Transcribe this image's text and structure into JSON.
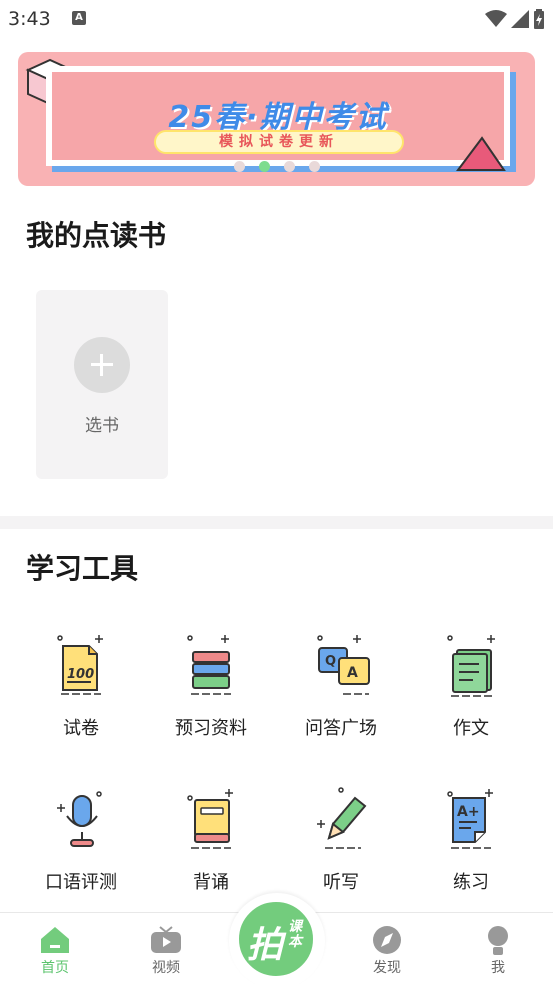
{
  "status_bar": {
    "time": "3:43",
    "notification_letter": "A"
  },
  "banner": {
    "title": "25春·期中考试",
    "subtitle": "模拟试卷更新",
    "dots": 4,
    "active_dot": 1
  },
  "my_books": {
    "title": "我的点读书",
    "add_label": "选书"
  },
  "tools": {
    "title": "学习工具",
    "items": [
      {
        "label": "试卷",
        "icon": "exam-paper-icon"
      },
      {
        "label": "预习资料",
        "icon": "book-stack-icon"
      },
      {
        "label": "问答广场",
        "icon": "qa-bubbles-icon"
      },
      {
        "label": "作文",
        "icon": "notebook-icon"
      },
      {
        "label": "口语评测",
        "icon": "microphone-icon"
      },
      {
        "label": "背诵",
        "icon": "yellow-book-icon"
      },
      {
        "label": "听写",
        "icon": "pencil-icon"
      },
      {
        "label": "练习",
        "icon": "a-plus-sheet-icon"
      }
    ]
  },
  "bottom_nav": {
    "items": [
      {
        "label": "首页",
        "icon": "home-icon",
        "active": true
      },
      {
        "label": "视频",
        "icon": "tv-icon",
        "active": false
      },
      {
        "label": "发现",
        "icon": "compass-icon",
        "active": false
      },
      {
        "label": "我",
        "icon": "user-icon",
        "active": false
      }
    ],
    "center": {
      "main": "拍",
      "small": "课本"
    }
  },
  "colors": {
    "accent": "#73cc7d",
    "banner_bg": "#f9b2b4",
    "banner_title": "#3f8be8"
  }
}
